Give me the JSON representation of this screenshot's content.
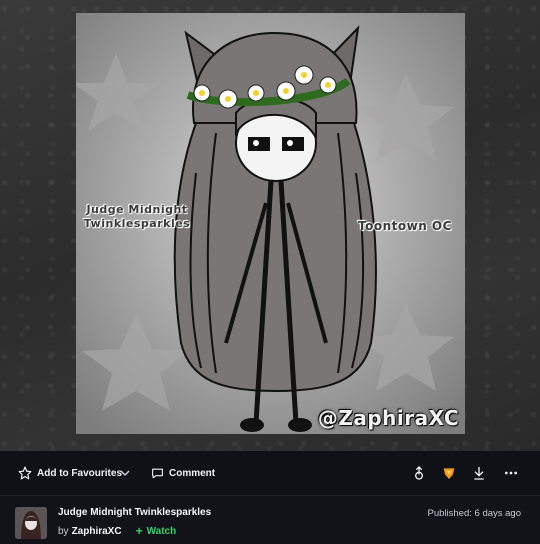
{
  "artwork": {
    "label_name": "Judge Midnight\nTwinklesparkles",
    "label_name_line1": "Judge Midnight",
    "label_name_line2": "Twinklesparkles",
    "label_oc": "Toontown OC",
    "label_handle": "@ZaphiraXC"
  },
  "actions": {
    "favourite_label": "Add to Favourites",
    "comment_label": "Comment",
    "icons": [
      "star-icon",
      "chevron-down-icon",
      "comment-icon",
      "share-icon",
      "badge-icon",
      "download-icon",
      "more-icon"
    ]
  },
  "deviation": {
    "title": "Judge Midnight Twinklesparkles",
    "by": "by",
    "author": "ZaphiraXC",
    "watch_label": "Watch",
    "published": "Published: 6 days ago"
  },
  "colors": {
    "background": "#111318",
    "watch_green": "#33d16b",
    "badge_orange": "#f39c1a"
  }
}
